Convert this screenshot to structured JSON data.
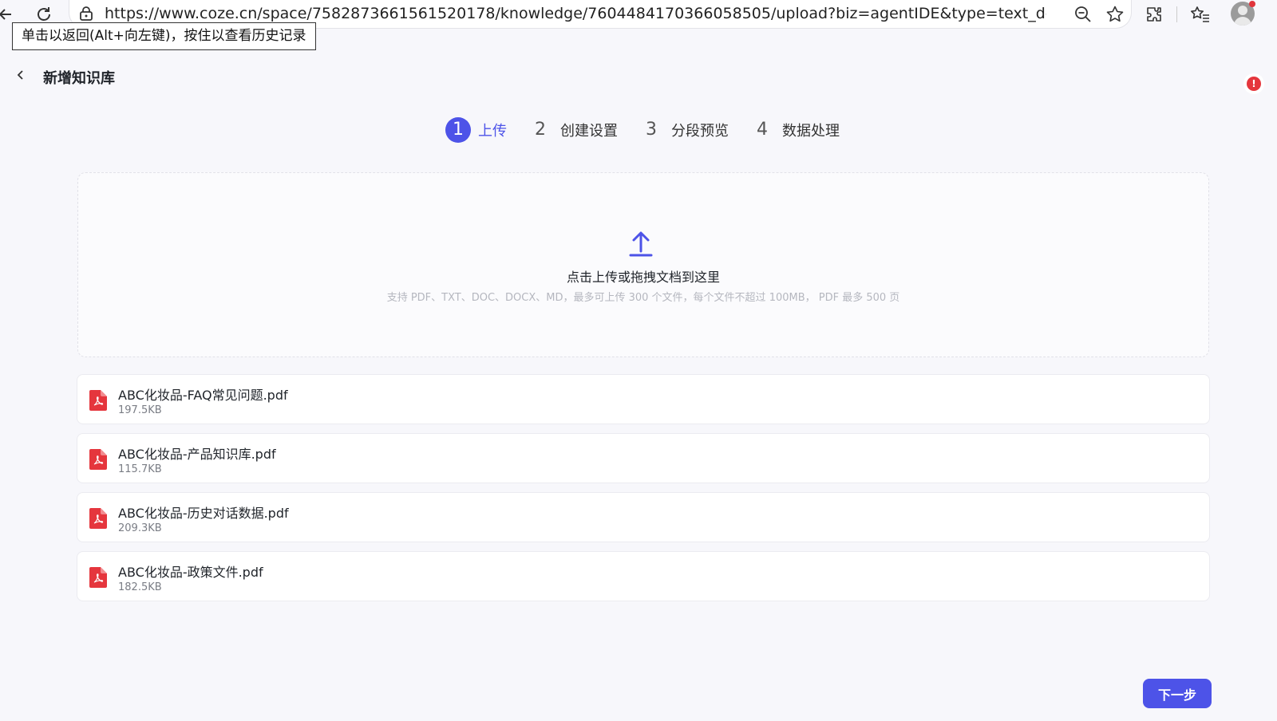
{
  "browser": {
    "url": "https://www.coze.cn/space/7582873661561520178/knowledge/7604484170366058505/upload?biz=agentIDE&type=text_doc&bot_...",
    "tooltip": "单击以返回(Alt+向左键)，按住以查看历史记录"
  },
  "header": {
    "title": "新增知识库",
    "alert": "!"
  },
  "steps": [
    {
      "num": "1",
      "label": "上传"
    },
    {
      "num": "2",
      "label": "创建设置"
    },
    {
      "num": "3",
      "label": "分段预览"
    },
    {
      "num": "4",
      "label": "数据处理"
    }
  ],
  "upload": {
    "title": "点击上传或拖拽文档到这里",
    "hint": "支持 PDF、TXT、DOC、DOCX、MD，最多可上传 300 个文件，每个文件不超过 100MB， PDF 最多 500 页"
  },
  "files": [
    {
      "name": "ABC化妆品-FAQ常见问题.pdf",
      "size": "197.5KB"
    },
    {
      "name": "ABC化妆品-产品知识库.pdf",
      "size": "115.7KB"
    },
    {
      "name": "ABC化妆品-历史对话数据.pdf",
      "size": "209.3KB"
    },
    {
      "name": "ABC化妆品-政策文件.pdf",
      "size": "182.5KB"
    }
  ],
  "footer": {
    "next_label": "下一步"
  },
  "colors": {
    "accent": "#4d53e8",
    "pdf_red": "#e5363d"
  }
}
